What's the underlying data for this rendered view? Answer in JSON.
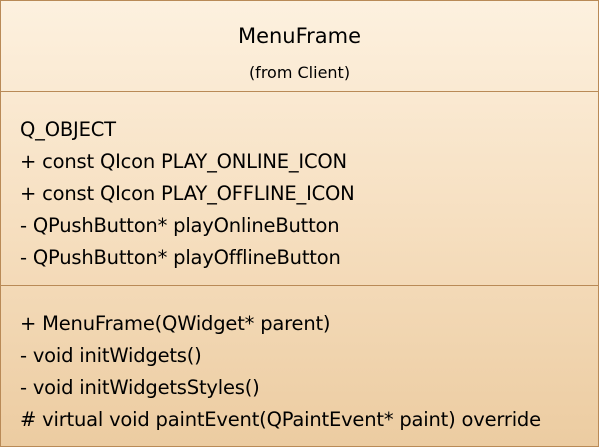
{
  "class": {
    "name": "MenuFrame",
    "package": "(from Client)"
  },
  "attributes": [
    "Q_OBJECT",
    "+ const QIcon PLAY_ONLINE_ICON",
    "+ const QIcon PLAY_OFFLINE_ICON",
    "- QPushButton* playOnlineButton",
    "- QPushButton* playOfflineButton"
  ],
  "operations": [
    "+ MenuFrame(QWidget* parent)",
    "- void initWidgets()",
    "- void initWidgetsStyles()",
    "# virtual void paintEvent(QPaintEvent* paint) override"
  ],
  "colors": {
    "fill_top": "#fdf1df",
    "fill_bottom": "#eccca1",
    "border": "#b98a57"
  }
}
